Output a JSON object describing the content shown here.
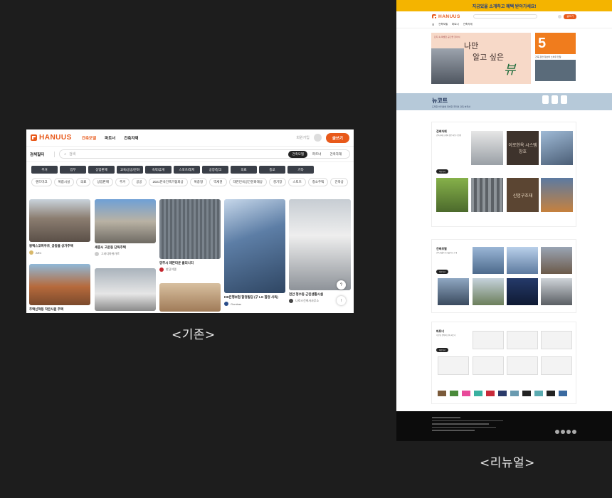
{
  "captions": {
    "old": "<기존>",
    "new": "<리뉴얼>"
  },
  "old_site": {
    "logo": "HANUUS",
    "nav": [
      "건축모델",
      "파트너",
      "건축자재"
    ],
    "login": "회원가입",
    "write_button": "글쓰기",
    "filter_label": "검색필터",
    "search_placeholder": "검색",
    "segments": [
      "건축모델",
      "파트너",
      "건축자재"
    ],
    "categories": [
      "주거",
      "업무",
      "상업판매",
      "교육/공공/문화",
      "숙박/휴게",
      "스포츠/레저",
      "공장/창고",
      "의료",
      "종교",
      "기타"
    ],
    "chips": [
      "랜드마크",
      "복합시설",
      "의료",
      "상업판매",
      "주거",
      "공공",
      "2021한국건축가협회상",
      "복층형",
      "역세권",
      "대한민국공간문화대상",
      "경기장",
      "스토츠",
      "청소주택",
      "건축상"
    ],
    "cards": [
      {
        "title": "봉택스코퍼우르_공동을 상가주택",
        "author": "ARC"
      },
      {
        "title": "세종시 고운동 단독주택",
        "author": "그라디아뮤가르"
      },
      {
        "title": "양주시 레몬타운 클리니티",
        "author": "한딩이템"
      },
      {
        "title": "KB은행보험 합정빌딩 (구 LG 합정 사옥)",
        "author": "Gombas"
      },
      {
        "title": "천안 청수동 근린생활시설",
        "author": "나로스건축사사무소"
      },
      {
        "title": "주택신혁동 작은사원 주택",
        "author": ""
      }
    ]
  },
  "new_site": {
    "promo": "지금있을 소개하고 혜택 받아가세요!",
    "logo": "HANUUS",
    "nav": [
      "건축모델",
      "파트너",
      "건축자재"
    ],
    "write_button": "글쓰기",
    "hero_line1": "나만",
    "hero_line2": "알고 싶은",
    "hero_line3": "뷰",
    "hero_small": "단지 속 특별한 공간을 찾아서",
    "side_number": "5",
    "side_caption": "건축 관련 정보와 노하우 전달",
    "band_title": "뉴코트",
    "band_sub": "도래한 바리넷에 대비한 최적의 건축 솔루션",
    "sec1_title": "건축자재",
    "sec1_desc": "건축자재 소개와 전문 파트너 연결",
    "sec1_btn": "바로가기",
    "sec1_thumb_text1": "이로한옥 시스템창호",
    "sec1_thumb_text2": "신업구조재",
    "sec2_title": "건축모델",
    "sec2_desc": "건축모델과 포트폴리오 소개",
    "sec2_btn": "바로가기",
    "sec3_title": "파트너",
    "sec3_desc": "다양한 분야의 건축 파트너",
    "sec3_btn": "바로가기"
  },
  "colors": {
    "brand": "#e8591a",
    "bg": "#1d1d1d"
  }
}
